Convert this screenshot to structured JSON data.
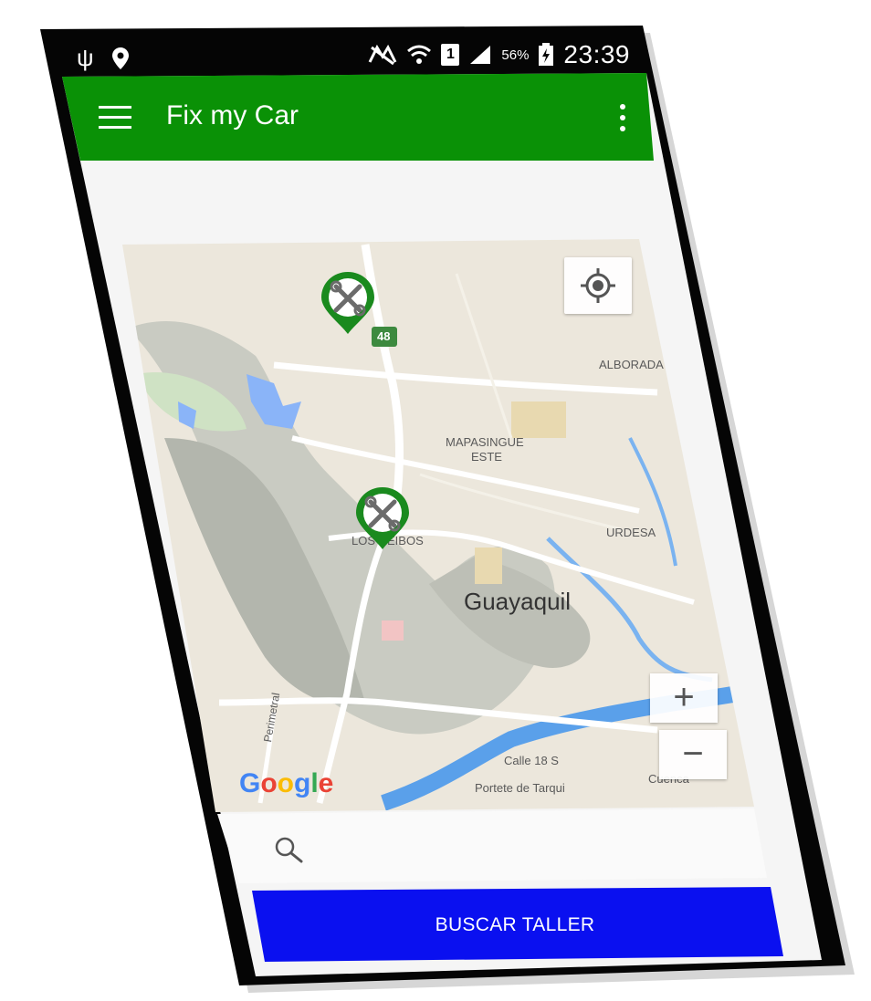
{
  "status_bar": {
    "battery_percent": "56%",
    "time": "23:39",
    "sim_label": "1"
  },
  "app_bar": {
    "title": "Fix my Car"
  },
  "map": {
    "labels": {
      "alborada": "ALBORADA",
      "mapasingue": "MAPASINGUE",
      "este": "ESTE",
      "urdesa": "URDESA",
      "los_ceibos": "LOS CEIBOS",
      "city": "Guayaquil",
      "calle": "Calle 18 S",
      "portete": "Portete de Tarqui",
      "cuenca": "Cuenca",
      "perimetral": "Perimetral",
      "highway": "48"
    },
    "zoom_in": "+",
    "zoom_out": "−",
    "attribution": "Google",
    "marker_icon": "wrench-icon",
    "accent": "#1a8a1e"
  },
  "search": {
    "placeholder": ""
  },
  "actions": {
    "search_button": "BUSCAR TALLER"
  },
  "colors": {
    "app_bar": "#0a9106",
    "button": "#0a10f0"
  }
}
